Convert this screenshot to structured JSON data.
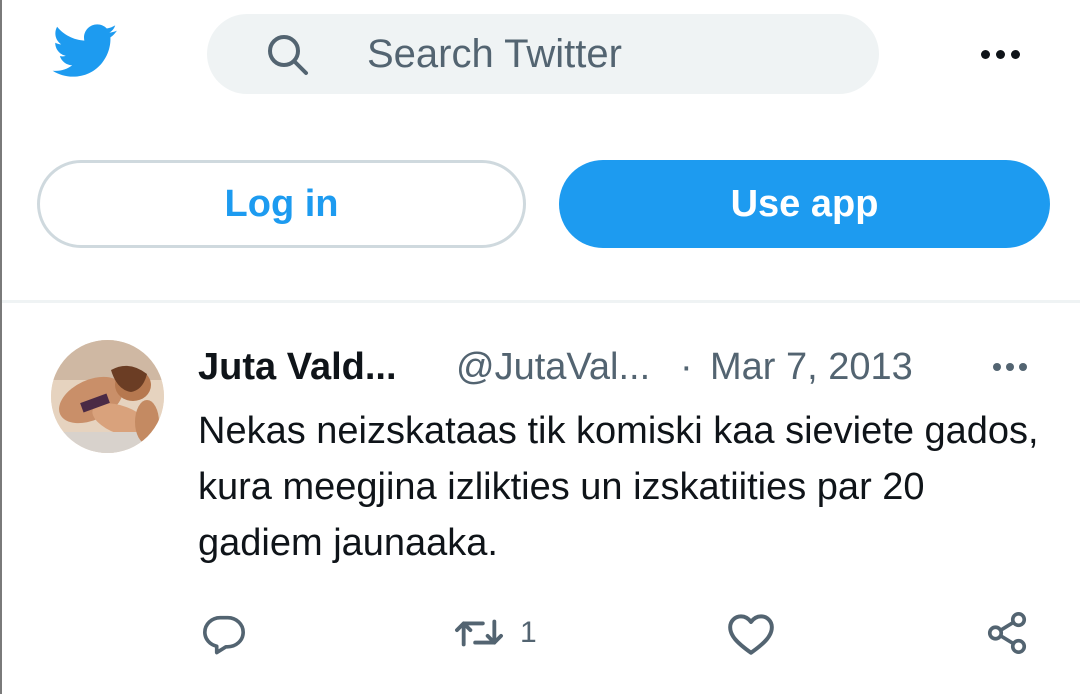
{
  "header": {
    "search_placeholder": "Search Twitter",
    "logo_icon": "twitter-bird-icon",
    "more_icon": "more-dots-icon"
  },
  "auth": {
    "login_label": "Log in",
    "use_app_label": "Use app"
  },
  "tweet": {
    "name": "Juta Vald...",
    "handle": "@JutaVal...",
    "separator": "·",
    "date": "Mar 7, 2013",
    "text": "Nekas neizskataas tik komiski kaa sieviete gados, kura meegjina izlikties un izskatiities par 20 gadiem jaunaaka.",
    "actions": {
      "reply_icon": "reply-icon",
      "retweet_icon": "retweet-icon",
      "retweet_count": "1",
      "like_icon": "heart-icon",
      "share_icon": "share-icon"
    }
  },
  "colors": {
    "accent": "#1d9bf0",
    "text": "#0f1419",
    "muted": "#536471",
    "search_bg": "#eff3f4",
    "border": "#cfd9de"
  }
}
